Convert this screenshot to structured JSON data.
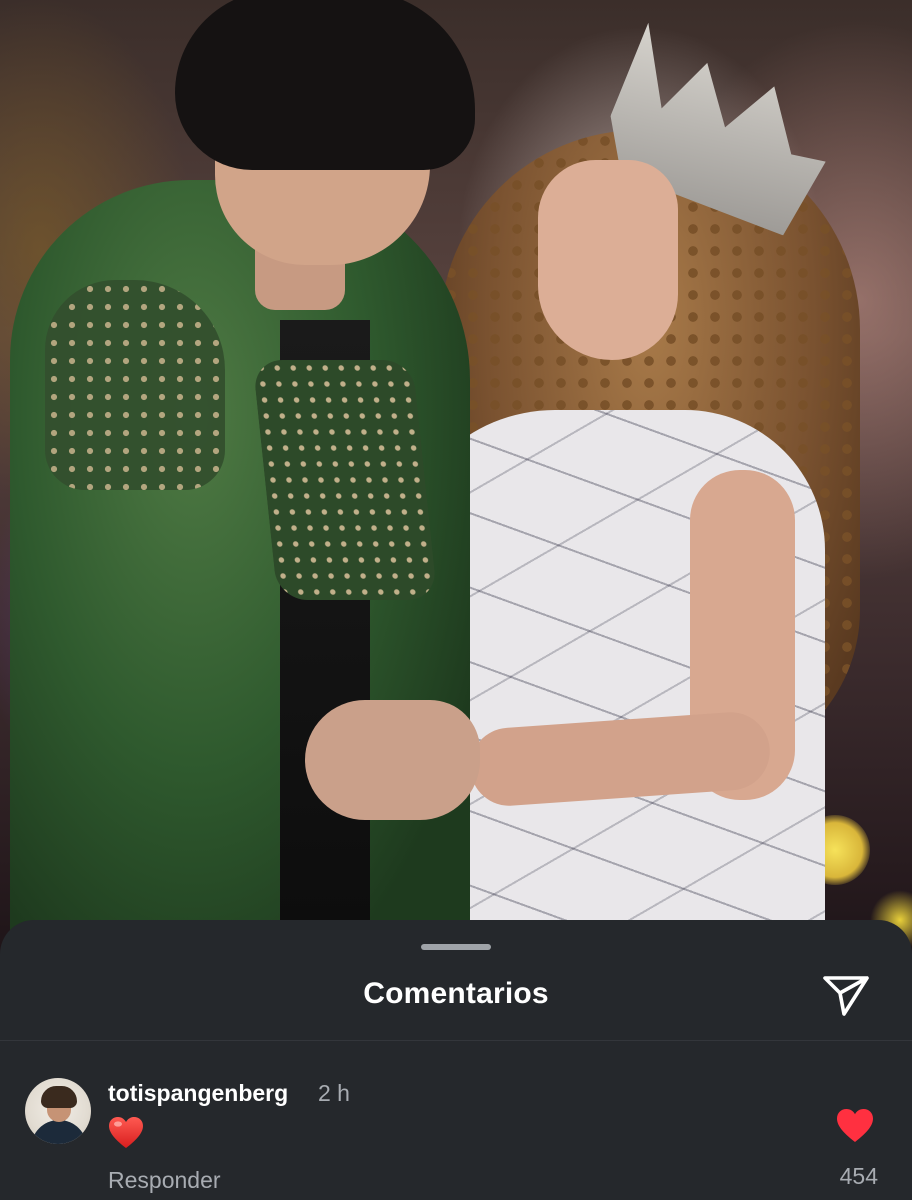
{
  "photo": {
    "description_icon": "photo-icon"
  },
  "comments_sheet": {
    "title": "Comentarios",
    "share_icon": "paper-plane-icon",
    "comment": {
      "username": "totispangenberg",
      "time": "2 h",
      "text_icon": "red-heart-emoji",
      "reply_label": "Responder",
      "like_icon": "heart-icon",
      "like_count": "454"
    }
  },
  "colors": {
    "sheet_background": "#25282c",
    "like_heart": "#ff3040",
    "secondary_text": "#a8acb2"
  }
}
